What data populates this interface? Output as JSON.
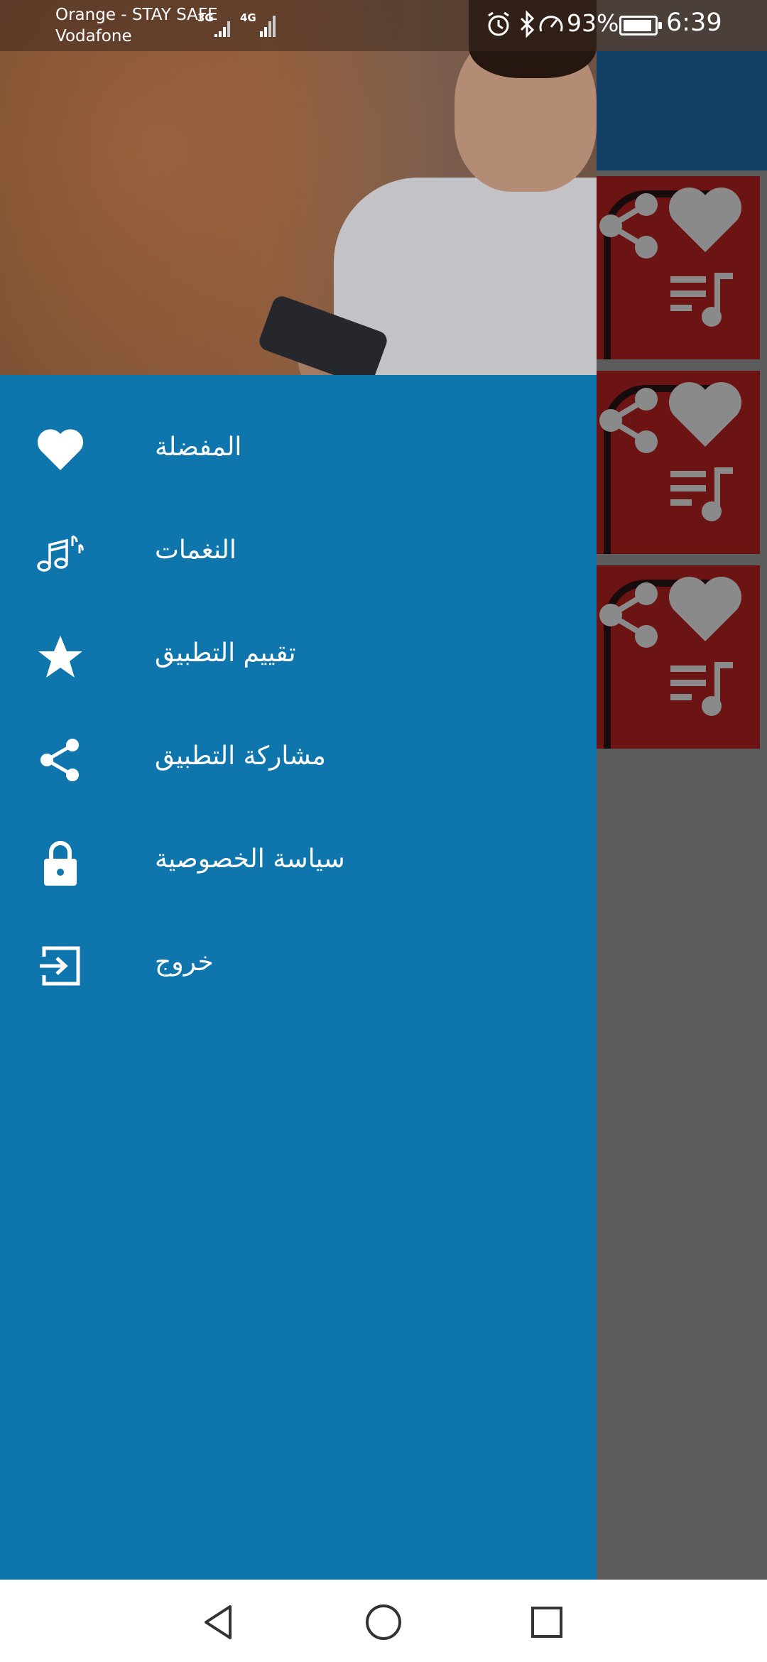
{
  "status_bar": {
    "carrier_primary": "Orange - STAY SAFE",
    "carrier_secondary": "Vodafone",
    "network_1": "3G",
    "network_2": "4G",
    "battery_percent": "93%",
    "battery_level": 0.93,
    "time": "6:39",
    "icons": [
      "alarm-icon",
      "bluetooth-icon",
      "data-saver-icon",
      "battery-charging-icon"
    ]
  },
  "drawer": {
    "background_color": "#0e76ad",
    "header_image": "singer-photo",
    "menu": [
      {
        "id": "favorites",
        "label": "المفضلة",
        "icon": "heart-icon"
      },
      {
        "id": "ringtones",
        "label": "النغمات",
        "icon": "music-notes-icon"
      },
      {
        "id": "rate",
        "label": "تقييم التطبيق",
        "icon": "star-icon"
      },
      {
        "id": "share",
        "label": "مشاركة التطبيق",
        "icon": "share-icon"
      },
      {
        "id": "privacy",
        "label": "سياسة الخصوصية",
        "icon": "lock-icon"
      },
      {
        "id": "exit",
        "label": "خروج",
        "icon": "exit-icon"
      }
    ]
  },
  "background_list": {
    "toolbar_color": "#1d6aa8",
    "card_color": "#b52222",
    "cards": [
      {
        "icons": [
          "share-icon",
          "heart-icon",
          "playlist-icon"
        ]
      },
      {
        "icons": [
          "share-icon",
          "heart-icon",
          "playlist-icon"
        ]
      },
      {
        "icons": [
          "share-icon",
          "heart-icon",
          "playlist-icon"
        ]
      }
    ]
  },
  "navigation_bar": {
    "buttons": [
      "back-icon",
      "home-icon",
      "recents-icon"
    ]
  }
}
